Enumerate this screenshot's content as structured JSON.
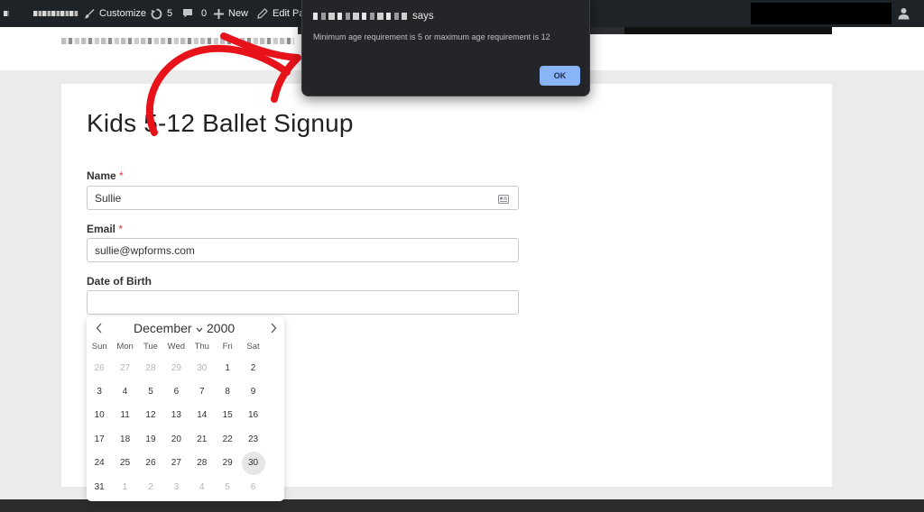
{
  "admin_bar": {
    "customize_label": "Customize",
    "updates_count": "5",
    "comments_count": "0",
    "new_label": "New",
    "edit_page_label": "Edit Pag"
  },
  "form": {
    "title": "Kids 5-12 Ballet Signup",
    "name_label": "Name",
    "name_required": "*",
    "name_value": "Sullie",
    "email_label": "Email",
    "email_required": "*",
    "email_value": "sullie@wpforms.com",
    "dob_label": "Date of Birth",
    "dob_value": ""
  },
  "datepicker": {
    "month": "December",
    "year": "2000",
    "weekdays": [
      "Sun",
      "Mon",
      "Tue",
      "Wed",
      "Thu",
      "Fri",
      "Sat"
    ],
    "weeks": [
      [
        {
          "d": "26",
          "muted": true
        },
        {
          "d": "27",
          "muted": true
        },
        {
          "d": "28",
          "muted": true
        },
        {
          "d": "29",
          "muted": true
        },
        {
          "d": "30",
          "muted": true
        },
        {
          "d": "1"
        },
        {
          "d": "2"
        }
      ],
      [
        {
          "d": "3"
        },
        {
          "d": "4"
        },
        {
          "d": "5"
        },
        {
          "d": "6"
        },
        {
          "d": "7"
        },
        {
          "d": "8"
        },
        {
          "d": "9"
        }
      ],
      [
        {
          "d": "10"
        },
        {
          "d": "11"
        },
        {
          "d": "12"
        },
        {
          "d": "13"
        },
        {
          "d": "14"
        },
        {
          "d": "15"
        },
        {
          "d": "16"
        }
      ],
      [
        {
          "d": "17"
        },
        {
          "d": "18"
        },
        {
          "d": "19"
        },
        {
          "d": "20"
        },
        {
          "d": "21"
        },
        {
          "d": "22"
        },
        {
          "d": "23"
        }
      ],
      [
        {
          "d": "24"
        },
        {
          "d": "25"
        },
        {
          "d": "26"
        },
        {
          "d": "27"
        },
        {
          "d": "28"
        },
        {
          "d": "29"
        },
        {
          "d": "30",
          "highlighted": true
        }
      ],
      [
        {
          "d": "31"
        },
        {
          "d": "1",
          "muted": true
        },
        {
          "d": "2",
          "muted": true
        },
        {
          "d": "3",
          "muted": true
        },
        {
          "d": "4",
          "muted": true
        },
        {
          "d": "5",
          "muted": true
        },
        {
          "d": "6",
          "muted": true
        }
      ]
    ]
  },
  "dialog": {
    "says": "says",
    "message": "Minimum age requirement is 5 or maximum age requirement is 12",
    "ok_label": "OK"
  },
  "colors": {
    "admin_bar": "#1d2327",
    "dialog_bg": "#242528",
    "ok_button": "#8ab4f8",
    "arrow": "#e8121b",
    "required": "#d63637"
  }
}
